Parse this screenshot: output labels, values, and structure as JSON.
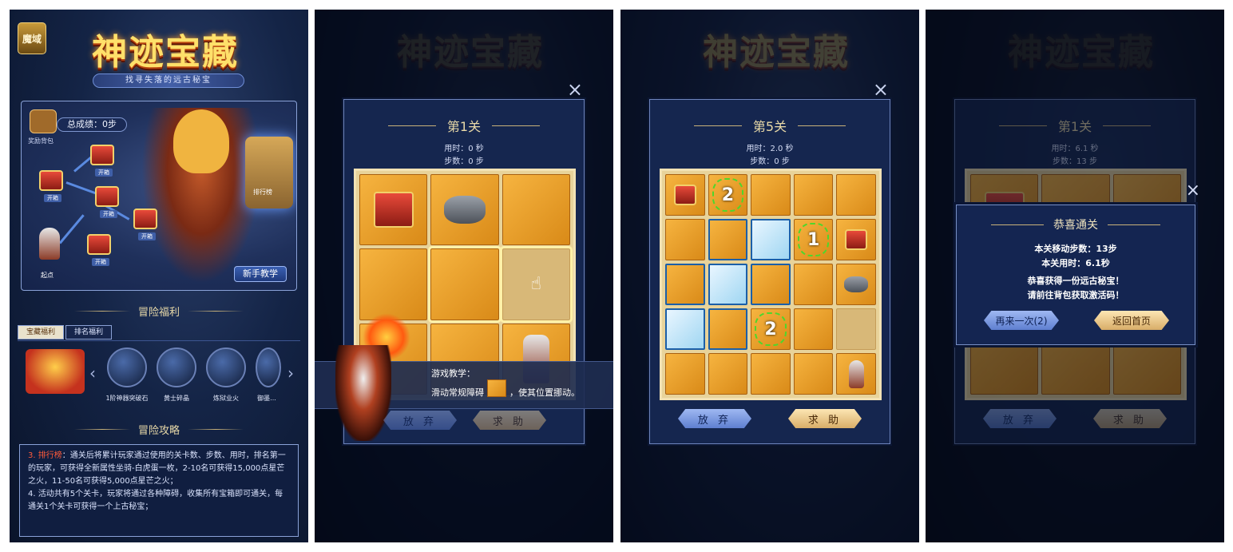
{
  "panel1": {
    "logo_text": "魔域",
    "title": "神迹宝藏",
    "subtitle": "找寻失落的远古秘宝",
    "total_score": "总成绩：0步",
    "bag_label": "奖励背包",
    "chest_label": "开箱",
    "rank_label": "排行榜",
    "start_label": "起点",
    "tutorial_button": "新手教学",
    "welfare_title": "冒险福利",
    "tabs": [
      "宝藏福利",
      "排名福利"
    ],
    "reward_items": [
      "1阶神器突破石",
      "黄士碎晶",
      "炼狱业火",
      "御墨..."
    ],
    "guide_title": "冒险攻略",
    "guide_lines": [
      {
        "label": "3. 排行榜",
        "text": "：通关后将累计玩家通过使用的关卡数、步数、用时，排名第一的玩家，可获得全新属性坐骑-白虎蛋一枚，2-10名可获得15,000点星芒之火，11-50名可获得5,000点星芒之火；"
      },
      {
        "label": "",
        "text": "4. 活动共有5个关卡，玩家将通过各种障碍，收集所有宝箱即可通关，每通关1个关卡可获得一个上古秘宝；"
      }
    ]
  },
  "panel2": {
    "close_icon": "×",
    "level": "第1关",
    "time": "用时：0 秒",
    "steps": "步数：0 步",
    "tip_title": "游戏教学：",
    "tip_text_a": "滑动常规障碍",
    "tip_text_b": "，使其位置挪动。",
    "give_up": "放 弃",
    "help": "求 助"
  },
  "panel3": {
    "close_icon": "×",
    "level": "第5关",
    "time": "用时：2.0 秒",
    "steps": "步数：0 步",
    "vine_numbers": [
      "2",
      "1",
      "2"
    ],
    "give_up": "放 弃",
    "help": "求 助"
  },
  "panel4": {
    "close_icon": "×",
    "bg_level": "第1关",
    "bg_time": "用时：6.1 秒",
    "bg_steps": "步数：13 步",
    "win_title": "恭喜通关",
    "move_steps": "本关移动步数：13步",
    "time_used": "本关用时：6.1秒",
    "congrats": "恭喜获得一份远古秘宝！",
    "go_bag": "请前往背包获取激活码！",
    "retry": "再来一次(2)",
    "home": "返回首页",
    "give_up": "放 弃",
    "help": "求 助"
  }
}
